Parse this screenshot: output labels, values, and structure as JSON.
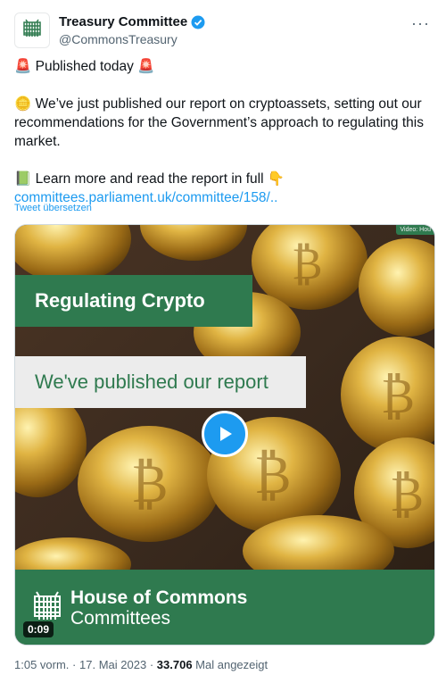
{
  "account": {
    "display_name": "Treasury Committee",
    "handle": "@CommonsTreasury",
    "verified_icon": "verified-badge-icon"
  },
  "tweet": {
    "line1": "🚨 Published today 🚨",
    "line2": "🪙 We’ve just published our report on cryptoassets, setting out our recommendations for the Government’s approach to regulating this market.",
    "line3": "📗 Learn more and read the report in full 👇",
    "link": "committees.parliament.uk/committee/158/..",
    "translate": "Tweet übersetzen"
  },
  "media": {
    "title": "Regulating Crypto",
    "subtitle": "We've published our report",
    "brand_line1": "House of Commons",
    "brand_line2": "Committees",
    "duration": "0:09",
    "corner_label": "Video: Hou"
  },
  "meta": {
    "time": "1:05 vorm.",
    "date": "17. Mai 2023",
    "views": "33.706",
    "views_label": "Mal angezeigt",
    "separator": "·"
  },
  "colors": {
    "brand_green": "#2f7a4f",
    "link_blue": "#1d9bf0",
    "verified_blue": "#1d9bf0"
  }
}
